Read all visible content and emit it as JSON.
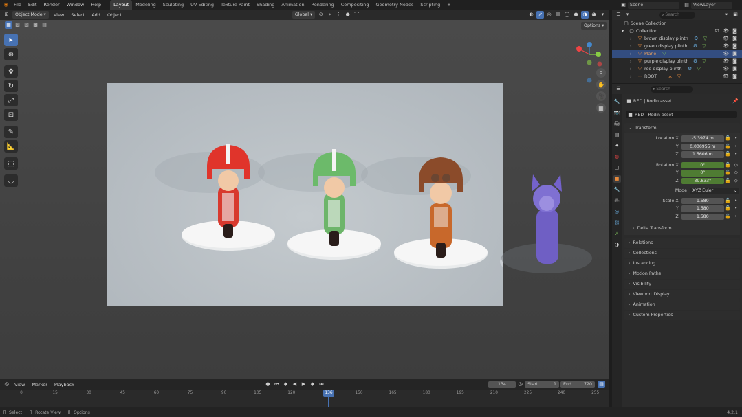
{
  "menus": [
    "File",
    "Edit",
    "Render",
    "Window",
    "Help"
  ],
  "workspaces": [
    "Layout",
    "Modeling",
    "Sculpting",
    "UV Editing",
    "Texture Paint",
    "Shading",
    "Animation",
    "Rendering",
    "Compositing",
    "Geometry Nodes",
    "Scripting"
  ],
  "scene_label": "Scene",
  "view_layer_label": "ViewLayer",
  "viewport": {
    "mode": "Object Mode",
    "menu": [
      "View",
      "Select",
      "Add",
      "Object"
    ],
    "transform_orientation": "Global",
    "options_label": "Options"
  },
  "outliner": {
    "search_placeholder": "Search",
    "root": "Scene Collection",
    "collection": "Collection",
    "items": [
      "brown display plinth",
      "green display plinth",
      "Plane",
      "purple display plinth",
      "red display plinth",
      "ROOT"
    ]
  },
  "properties": {
    "search_placeholder": "Search",
    "breadcrumb": "RED | Rodin asset",
    "object_name": "RED | Rodin asset",
    "transform_title": "Transform",
    "location": {
      "label": "Location X",
      "y_label": "Y",
      "z_label": "Z",
      "x": "-5.3974 m",
      "y": "0.006955 m",
      "z": "1.5606 m"
    },
    "rotation": {
      "label": "Rotation X",
      "y_label": "Y",
      "z_label": "Z",
      "x": "0°",
      "y": "0°",
      "z": "39.833°"
    },
    "mode": {
      "label": "Mode",
      "value": "XYZ Euler"
    },
    "scale": {
      "label": "Scale X",
      "y_label": "Y",
      "z_label": "Z",
      "x": "1.580",
      "y": "1.580",
      "z": "1.580"
    },
    "delta_transform": "Delta Transform",
    "panels": [
      "Relations",
      "Collections",
      "Instancing",
      "Motion Paths",
      "Visibility",
      "Viewport Display",
      "Animation",
      "Custom Properties"
    ]
  },
  "timeline": {
    "menu": [
      "View",
      "Marker",
      "Playback"
    ],
    "current_frame": "134",
    "start_label": "Start",
    "start": "1",
    "end_label": "End",
    "end": "720",
    "ticks": [
      "0",
      "15",
      "30",
      "45",
      "60",
      "75",
      "90",
      "105",
      "120",
      "136",
      "150",
      "165",
      "180",
      "195",
      "210",
      "225",
      "240",
      "255"
    ],
    "playhead": "136"
  },
  "statusbar": {
    "items": [
      "Select",
      "Rotate View",
      "Options"
    ],
    "version": "4.2.1"
  },
  "colors": {
    "accent": "#4772b3",
    "selected_row": "#334d80",
    "green_field": "#4f7c33"
  }
}
